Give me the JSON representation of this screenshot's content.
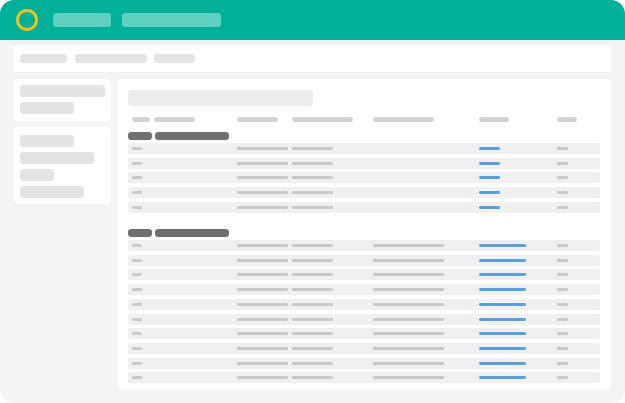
{
  "app": {
    "brand_color": "#00b099",
    "logo_icon": "ring-icon",
    "logo_color": "#f2c21b",
    "top_nav": [
      {
        "label": ""
      },
      {
        "label": ""
      }
    ]
  },
  "subbar": {
    "items": [
      {
        "label": ""
      },
      {
        "label": ""
      },
      {
        "label": ""
      }
    ]
  },
  "sidebar": {
    "cards": [
      {
        "items": [
          {
            "label": ""
          },
          {
            "label": ""
          }
        ]
      },
      {
        "items": [
          {
            "label": ""
          },
          {
            "label": ""
          },
          {
            "label": ""
          },
          {
            "label": ""
          }
        ]
      }
    ]
  },
  "main": {
    "title": "",
    "columns": [
      {
        "label": ""
      },
      {
        "label": ""
      },
      {
        "label": ""
      },
      {
        "label": ""
      },
      {
        "label": ""
      },
      {
        "label": ""
      },
      {
        "label": ""
      }
    ],
    "accent_color": "#5aa0dd",
    "groups": [
      {
        "title": "",
        "rows": [
          {
            "cells": [
              "",
              "",
              "",
              "",
              "",
              ""
            ]
          },
          {
            "cells": [
              "",
              "",
              "",
              "",
              "",
              ""
            ]
          },
          {
            "cells": [
              "",
              "",
              "",
              "",
              "",
              ""
            ]
          },
          {
            "cells": [
              "",
              "",
              "",
              "",
              "",
              ""
            ]
          },
          {
            "cells": [
              "",
              "",
              "",
              "",
              "",
              ""
            ]
          }
        ]
      },
      {
        "title": "",
        "rows": [
          {
            "cells": [
              "",
              "",
              "",
              "",
              "",
              ""
            ]
          },
          {
            "cells": [
              "",
              "",
              "",
              "",
              "",
              ""
            ]
          },
          {
            "cells": [
              "",
              "",
              "",
              "",
              "",
              ""
            ]
          },
          {
            "cells": [
              "",
              "",
              "",
              "",
              "",
              ""
            ]
          },
          {
            "cells": [
              "",
              "",
              "",
              "",
              "",
              ""
            ]
          },
          {
            "cells": [
              "",
              "",
              "",
              "",
              "",
              ""
            ]
          },
          {
            "cells": [
              "",
              "",
              "",
              "",
              "",
              ""
            ]
          },
          {
            "cells": [
              "",
              "",
              "",
              "",
              "",
              ""
            ]
          },
          {
            "cells": [
              "",
              "",
              "",
              "",
              "",
              ""
            ]
          },
          {
            "cells": [
              "",
              "",
              "",
              "",
              "",
              ""
            ]
          }
        ]
      }
    ]
  }
}
